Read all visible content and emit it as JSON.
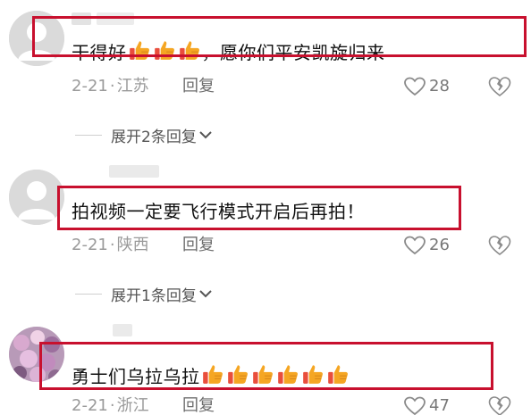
{
  "comments": [
    {
      "text": "干得好",
      "text_after": "，愿你们平安凯旋归来",
      "thumbs_count": 3,
      "date": "2-21",
      "location": "江苏",
      "reply_label": "回复",
      "likes": "28",
      "expand_label": "展开2条回复"
    },
    {
      "text": "拍视频一定要飞行模式开启后再拍！",
      "date": "2-21",
      "location": "陕西",
      "reply_label": "回复",
      "likes": "26",
      "expand_label": "展开1条回复"
    },
    {
      "text": "勇士们乌拉乌拉",
      "thumbs_count": 6,
      "date": "2-21",
      "location": "浙江",
      "reply_label": "回复",
      "likes": "47"
    }
  ],
  "colors": {
    "highlight": "#c8102e",
    "meta_text": "#9a9a9a",
    "thumbs": "#f5a623"
  },
  "icons": {
    "like": "heart-outline-icon",
    "dislike": "broken-heart-icon",
    "thumbs": "thumbs-up-emoji-icon",
    "expand": "chevron-down-icon"
  }
}
